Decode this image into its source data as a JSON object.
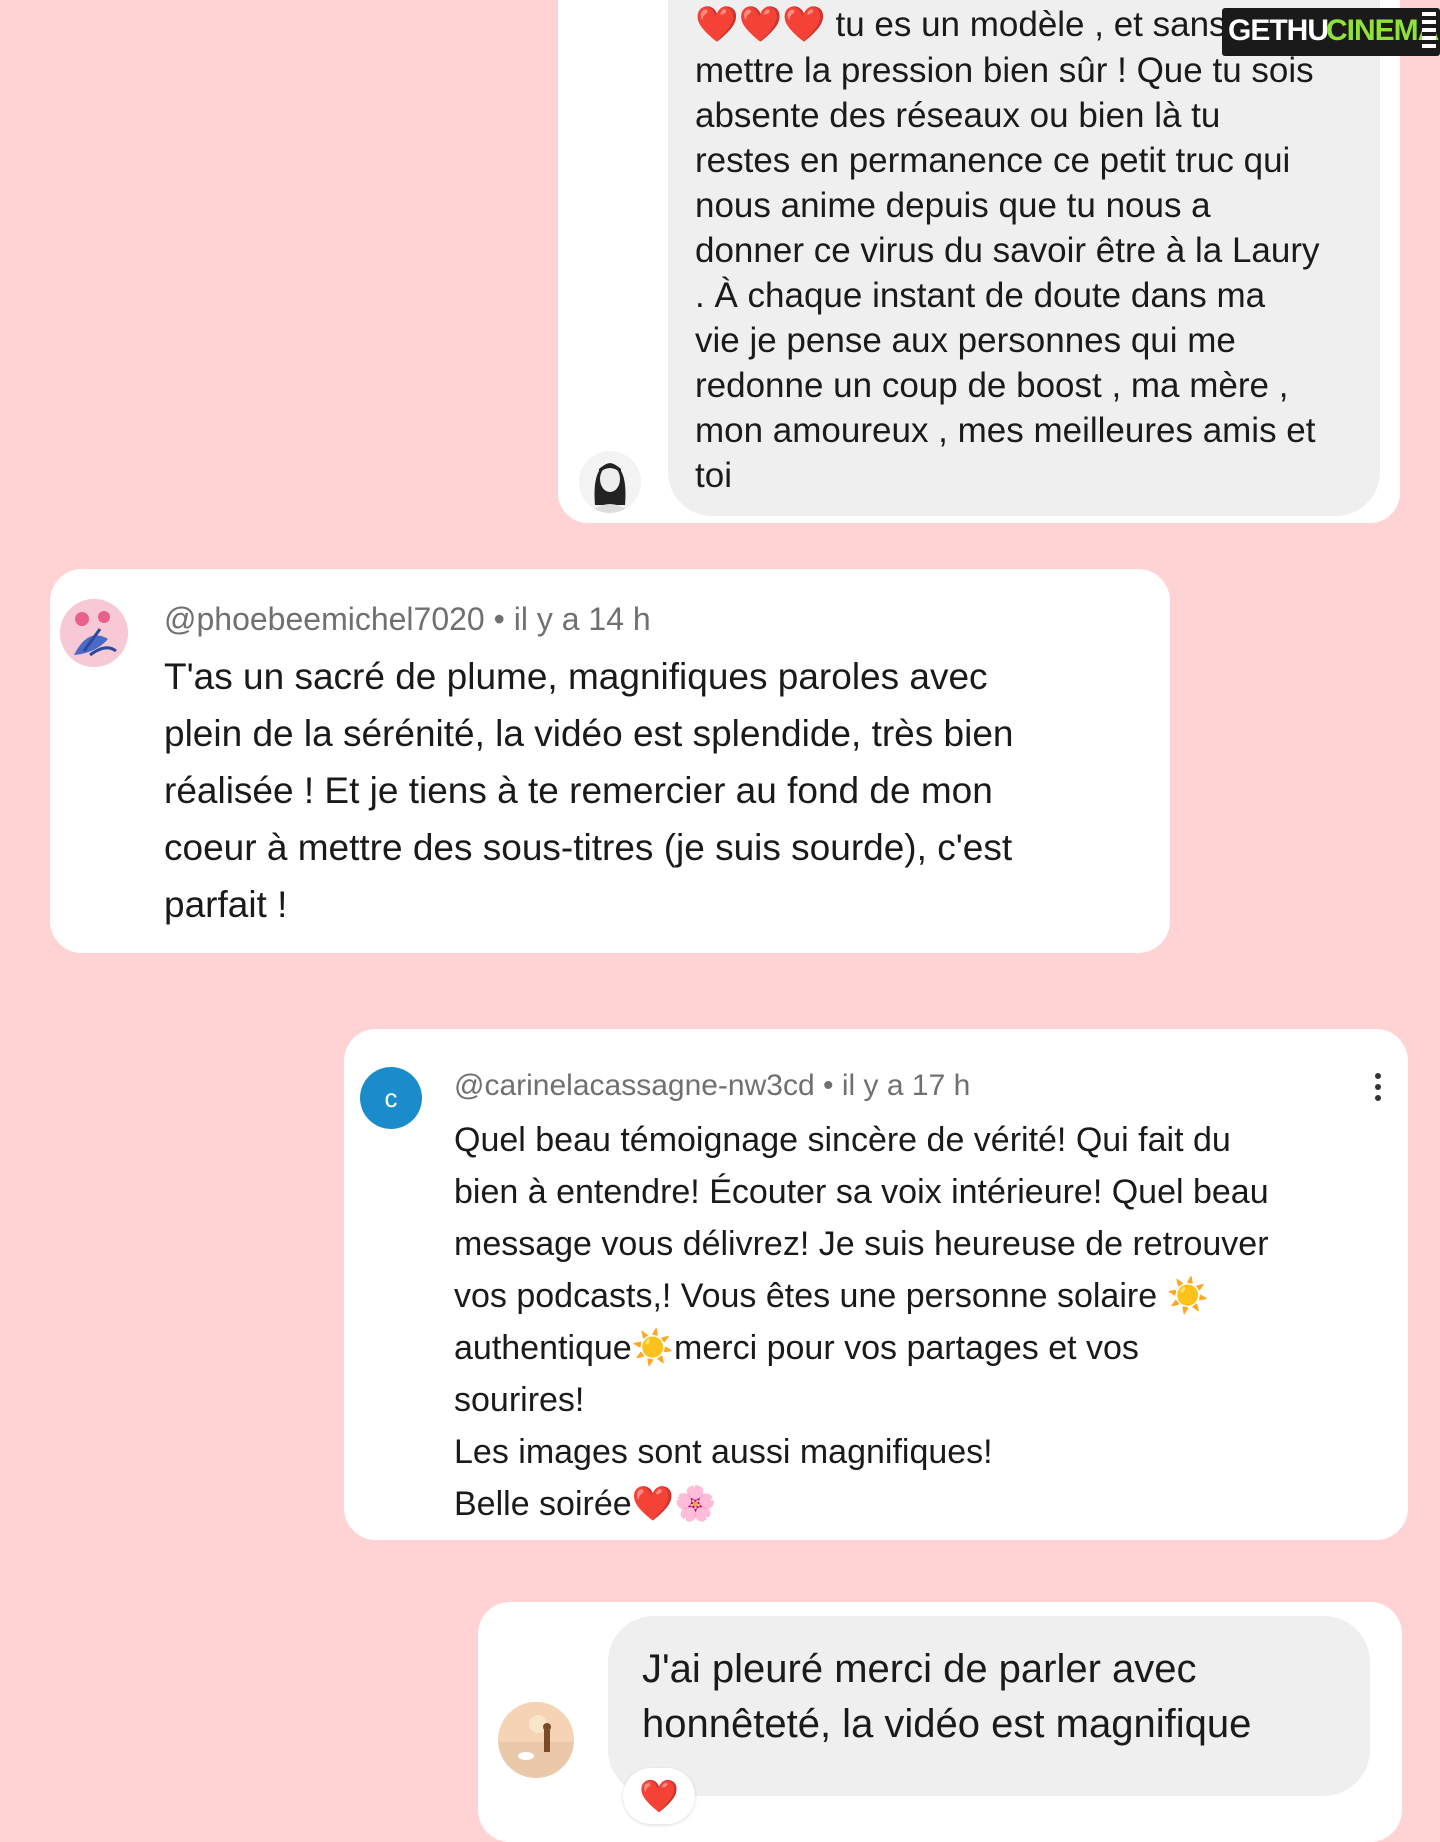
{
  "watermark": {
    "part1": "GETHU",
    "part2": "CINEMA"
  },
  "comments": [
    {
      "id": "comment-1",
      "heart_reaction": "❤️❤️❤️",
      "text": " tu es un modèle , et sans\nmettre la pression bien sûr ! Que tu sois\nabsente des réseaux ou bien là tu\nrestes en permanence ce petit truc qui\nnous anime depuis que tu nous a\ndonner ce virus du savoir être à la Laury\n. À chaque instant de doute dans ma\nvie je pense aux personnes qui me\nredonne un coup de boost , ma mère ,\nmon amoureux , mes meilleures amis et\ntoi"
    },
    {
      "id": "comment-2",
      "username": "@phoebeemichel7020",
      "separator": "•",
      "time": "il y a 14 h",
      "text": "T'as un sacré de plume, magnifiques paroles avec\nplein de la sérénité, la vidéo est splendide,  très bien\nréalisée ! Et je tiens à te remercier au fond de mon\ncoeur  à mettre des sous-titres (je suis sourde), c'est\nparfait !"
    },
    {
      "id": "comment-3",
      "avatar_letter": "c",
      "username": "@carinelacassagne-nw3cd",
      "separator": "•",
      "time": "il y a 17 h",
      "more_icon": "more-vertical-icon",
      "text": "Quel beau témoignage sincère de vérité! Qui fait du\nbien à entendre! Écouter sa voix intérieure!  Quel beau\nmessage vous délivrez! Je suis heureuse de retrouver\nvos podcasts,! Vous êtes une personne solaire ☀️\nauthentique☀️merci pour vos partages et vos\nsourires!\nLes images sont aussi magnifiques!\nBelle soirée❤️🌸"
    },
    {
      "id": "comment-4",
      "text": "J'ai pleuré merci de parler avec\nhonnêteté,  la vidéo est magnifique",
      "reaction": "❤️"
    }
  ],
  "colors": {
    "background": "#ffd2d3",
    "card": "#ffffff",
    "bubble": "#efefef",
    "meta": "#707070",
    "avatar_c": "#1a8ccc",
    "heart": "#e11d2a"
  }
}
